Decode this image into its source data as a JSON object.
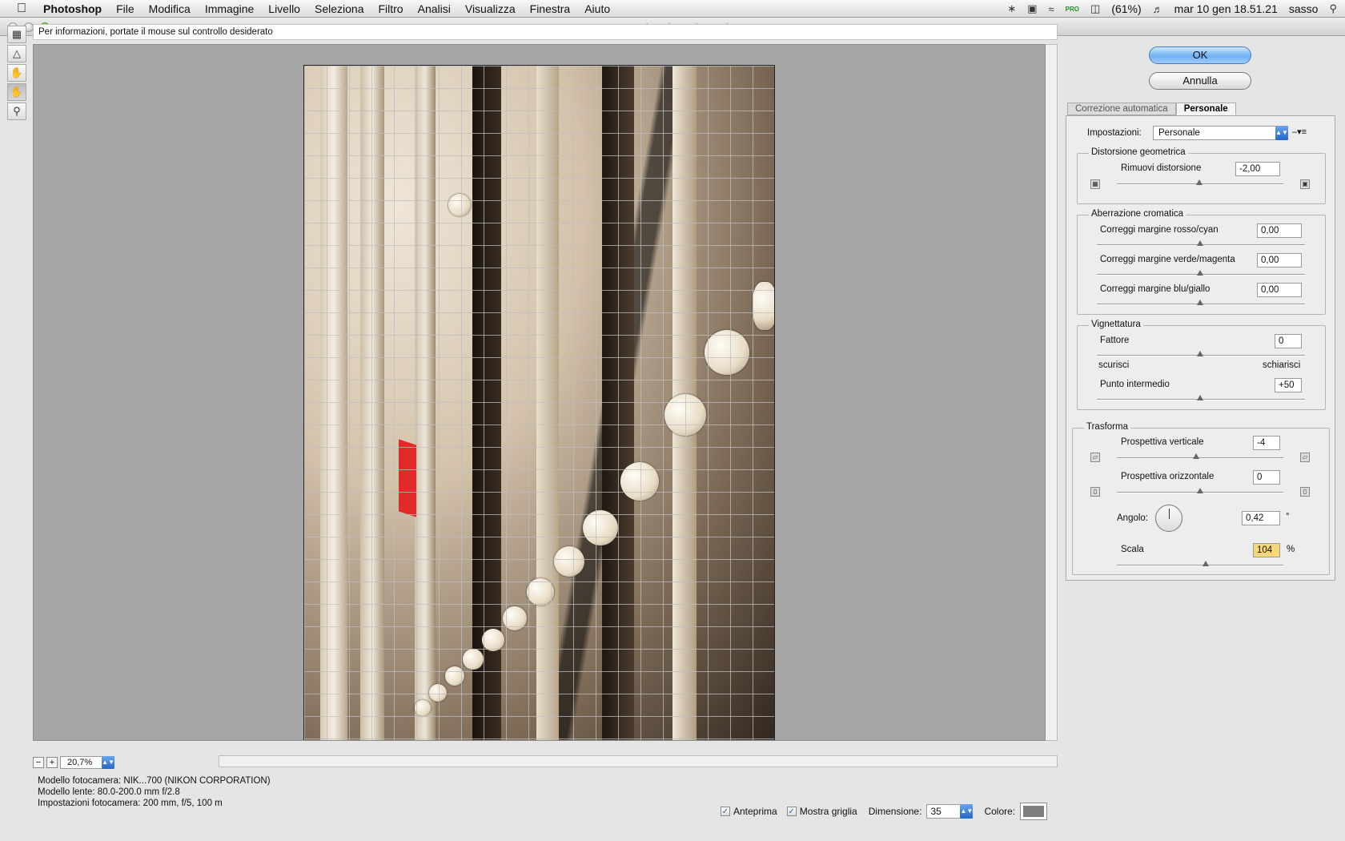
{
  "menubar": {
    "app": "Photoshop",
    "items": [
      "File",
      "Modifica",
      "Immagine",
      "Livello",
      "Seleziona",
      "Filtro",
      "Analisi",
      "Visualizza",
      "Finestra",
      "Aiuto"
    ],
    "battery": "(61%)",
    "clock": "mar 10 gen  18.51.21",
    "user": "sasso",
    "flag_label": "PRO"
  },
  "window": {
    "title": "Correzione lente (20,7%)"
  },
  "info_bar": "Per informazioni, portate il mouse sul controllo desiderato",
  "zoom": {
    "value": "20,7%"
  },
  "camera_info": {
    "model": "Modello fotocamera: NIK...700 (NIKON CORPORATION)",
    "lens": "Modello lente: 80.0-200.0 mm f/2.8",
    "settings": "Impostazioni fotocamera: 200 mm, f/5, 100 m"
  },
  "bottom": {
    "preview_label": "Anteprima",
    "grid_label": "Mostra griglia",
    "size_label": "Dimensione:",
    "size_value": "35",
    "color_label": "Colore:",
    "grid_color": "#7d7d7d"
  },
  "buttons": {
    "ok": "OK",
    "cancel": "Annulla"
  },
  "tabs": [
    "Correzione automatica",
    "Personale"
  ],
  "settings": {
    "label": "Impostazioni:",
    "value": "Personale"
  },
  "distortion": {
    "title": "Distorsione geometrica",
    "remove_label": "Rimuovi distorsione",
    "remove_value": "-2,00"
  },
  "chromatic": {
    "title": "Aberrazione cromatica",
    "red_cyan_label": "Correggi margine rosso/cyan",
    "red_cyan_value": "0,00",
    "green_magenta_label": "Correggi margine verde/magenta",
    "green_magenta_value": "0,00",
    "blue_yellow_label": "Correggi margine blu/giallo",
    "blue_yellow_value": "0,00"
  },
  "vignette": {
    "title": "Vignettatura",
    "amount_label": "Fattore",
    "amount_value": "0",
    "darken_label": "scurisci",
    "lighten_label": "schiarisci",
    "midpoint_label": "Punto intermedio",
    "midpoint_value": "+50"
  },
  "transform": {
    "title": "Trasforma",
    "vertical_label": "Prospettiva verticale",
    "vertical_value": "-4",
    "horizontal_label": "Prospettiva orizzontale",
    "horizontal_value": "0",
    "angle_label": "Angolo:",
    "angle_value": "0,42",
    "angle_unit": "°",
    "scale_label": "Scala",
    "scale_value": "104",
    "scale_unit": "%"
  }
}
